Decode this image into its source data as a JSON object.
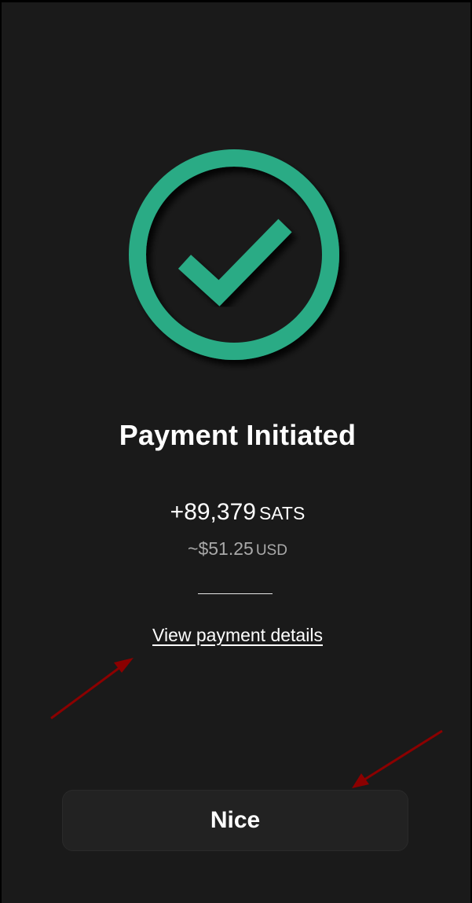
{
  "colors": {
    "background": "#1a1a1a",
    "accent": "#2aab85",
    "button_bg": "#222222",
    "annotation_arrow": "#8b0000"
  },
  "icons": {
    "status": "check-circle-icon"
  },
  "status": {
    "title": "Payment Initiated"
  },
  "amount": {
    "value": "+89,379",
    "unit": "SATS"
  },
  "fiat": {
    "value": "~$51.25",
    "unit": "USD"
  },
  "links": {
    "view_details": "View payment details"
  },
  "actions": {
    "primary_label": "Nice"
  }
}
